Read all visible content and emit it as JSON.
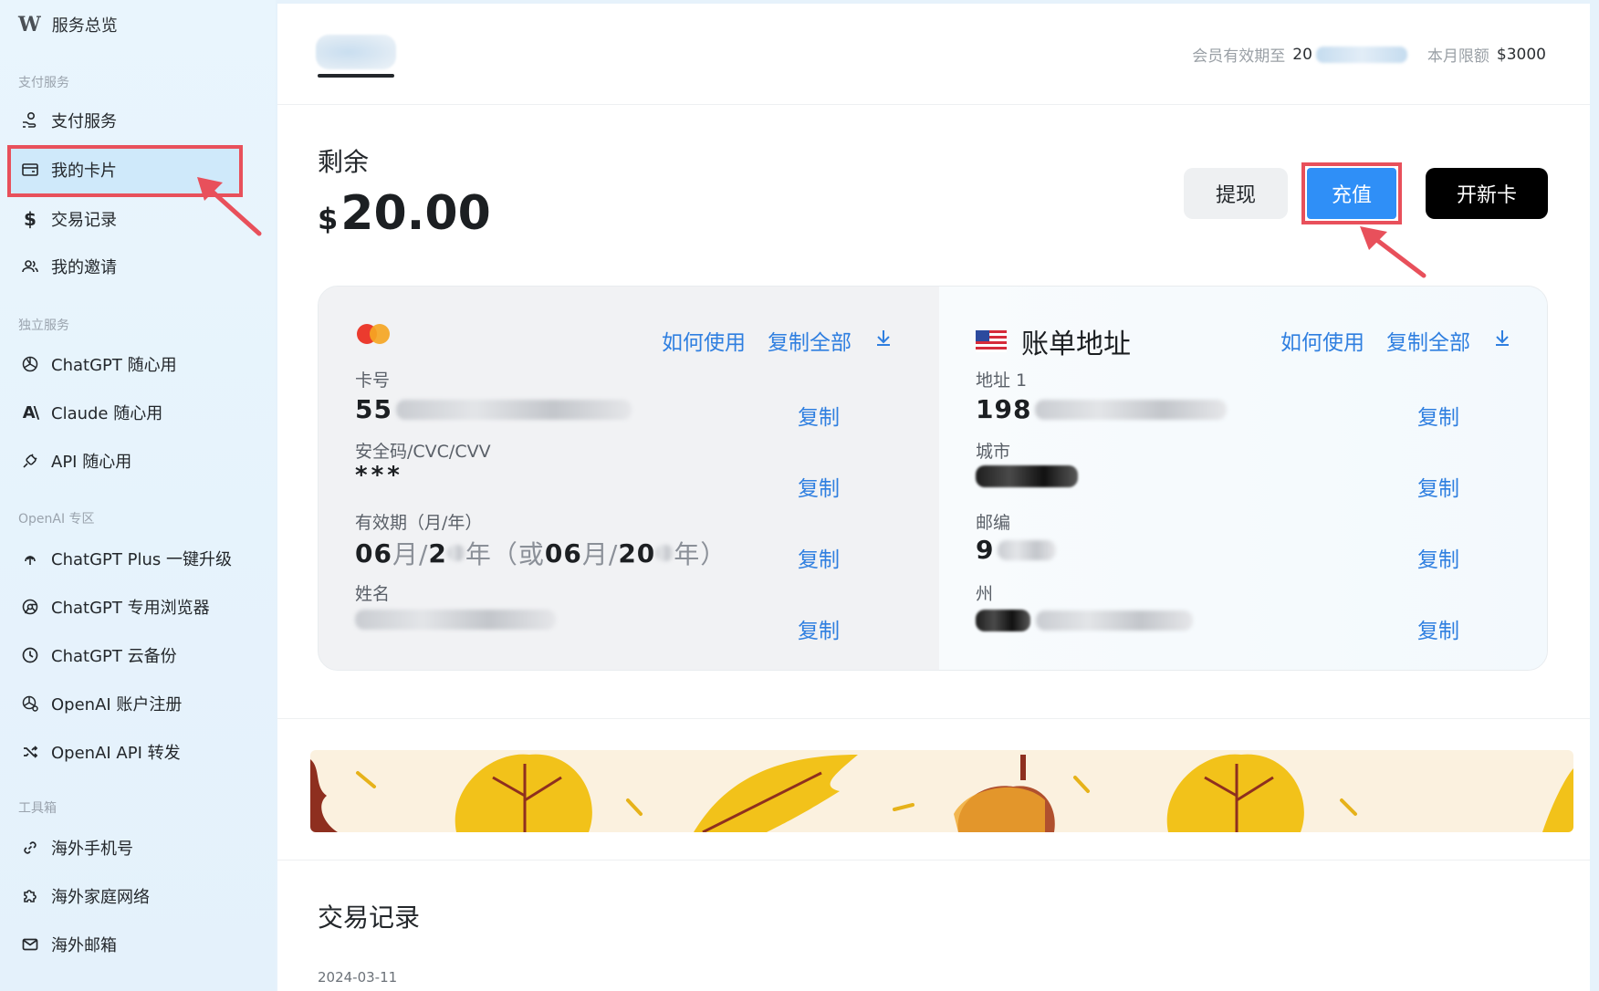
{
  "sidebar": {
    "brand_logo": "W",
    "brand_title": "服务总览",
    "sections": [
      {
        "label": "支付服务"
      },
      {
        "label": "独立服务"
      },
      {
        "label": "OpenAI 专区"
      },
      {
        "label": "工具箱"
      }
    ],
    "items": [
      {
        "label": "支付服务",
        "icon": "payment-hand-icon"
      },
      {
        "label": "我的卡片",
        "icon": "card-icon",
        "active": true
      },
      {
        "label": "交易记录",
        "icon": "dollar-icon"
      },
      {
        "label": "我的邀请",
        "icon": "users-icon"
      },
      {
        "label": "ChatGPT 随心用",
        "icon": "openai-icon"
      },
      {
        "label": "Claude 随心用",
        "icon": "anthropic-icon"
      },
      {
        "label": "API 随心用",
        "icon": "plug-icon"
      },
      {
        "label": "ChatGPT Plus 一键升级",
        "icon": "upgrade-icon"
      },
      {
        "label": "ChatGPT 专用浏览器",
        "icon": "browser-icon"
      },
      {
        "label": "ChatGPT 云备份",
        "icon": "clock-icon"
      },
      {
        "label": "OpenAI 账户注册",
        "icon": "openai-register-icon"
      },
      {
        "label": "OpenAI API 转发",
        "icon": "shuffle-icon"
      },
      {
        "label": "海外手机号",
        "icon": "link-icon"
      },
      {
        "label": "海外家庭网络",
        "icon": "puzzle-icon"
      },
      {
        "label": "海外邮箱",
        "icon": "mail-icon"
      }
    ]
  },
  "header": {
    "membership_label": "会员有效期至",
    "membership_value_prefix": "20",
    "limit_label": "本月限额",
    "limit_value": "$3000"
  },
  "balance": {
    "label": "剩余",
    "currency": "$",
    "amount": "20.00"
  },
  "actions": {
    "withdraw": "提现",
    "topup": "充值",
    "new_card": "开新卡"
  },
  "card": {
    "how_to": "如何使用",
    "copy_all": "复制全部",
    "copy": "复制",
    "number_label": "卡号",
    "number_prefix": "55",
    "cvc_label": "安全码/CVC/CVV",
    "cvc_value": "***",
    "expiry_label": "有效期（月/年）",
    "expiry_month": "06",
    "expiry_month_unit": "月/",
    "expiry_year_prefix": "2",
    "expiry_year_unit": "年",
    "expiry_alt_open": "（或",
    "expiry_alt_month": "06",
    "expiry_alt_month_unit": "月/",
    "expiry_alt_year_prefix": "20",
    "expiry_alt_close": "年）",
    "name_label": "姓名"
  },
  "billing": {
    "title": "账单地址",
    "how_to": "如何使用",
    "copy_all": "复制全部",
    "copy": "复制",
    "address_label": "地址 1",
    "address_prefix": "198",
    "city_label": "城市",
    "zip_label": "邮编",
    "zip_prefix": "9",
    "state_label": "州"
  },
  "transactions": {
    "title": "交易记录",
    "first_date": "2024-03-11"
  },
  "colors": {
    "accent": "#2f8ff7",
    "link": "#2f7fe0",
    "highlight": "#e8505b"
  }
}
